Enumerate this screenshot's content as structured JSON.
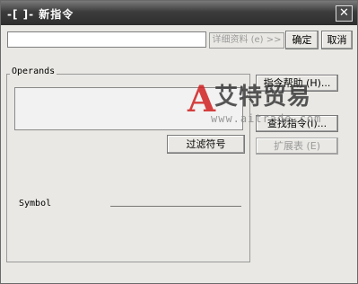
{
  "window": {
    "title": "-[ ]- 新指令"
  },
  "toolbar": {
    "command_value": "",
    "detail_label": "详细资料 (e) >>",
    "ok_label": "确定",
    "cancel_label": "取消"
  },
  "operands": {
    "group_label": "Operands",
    "filter_label": "过滤符号",
    "symbol_label": "Symbol"
  },
  "side_buttons": {
    "help_label": "指令帮助 (H)...",
    "find_label": "查找指令(I)...",
    "extend_label": "扩展表 (E)"
  },
  "watermark": {
    "logo": "A",
    "name": "艾特贸易",
    "url": "www.aitrade.com"
  },
  "icons": {
    "close": "close-icon"
  }
}
